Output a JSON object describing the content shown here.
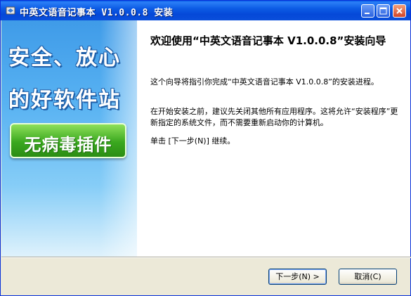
{
  "window": {
    "title": "中英文语音记事本 V1.0.0.8 安装",
    "controls": {
      "minimize_icon": "minimize-icon",
      "maximize_icon": "maximize-icon",
      "close_icon": "close-icon"
    }
  },
  "sidebar": {
    "line1": "安全、放心",
    "line2": "的好软件站",
    "badge": "无病毒插件"
  },
  "content": {
    "heading": "欢迎使用“中英文语音记事本 V1.0.0.8”安装向导",
    "para1": "这个向导将指引你完成“中英文语音记事本 V1.0.0.8”的安装进程。",
    "para2": "在开始安装之前，建议先关闭其他所有应用程序。这将允许“安装程序”更新指定的系统文件，而不需要重新启动你的计算机。",
    "para3": "单击 [下一步(N)] 继续。"
  },
  "buttons": {
    "next": "下一步(N) >",
    "cancel": "取消(C)"
  },
  "colors": {
    "titlebar": "#0548d8",
    "badge": "#3aa81f",
    "sidebar": "#58b2f2"
  }
}
